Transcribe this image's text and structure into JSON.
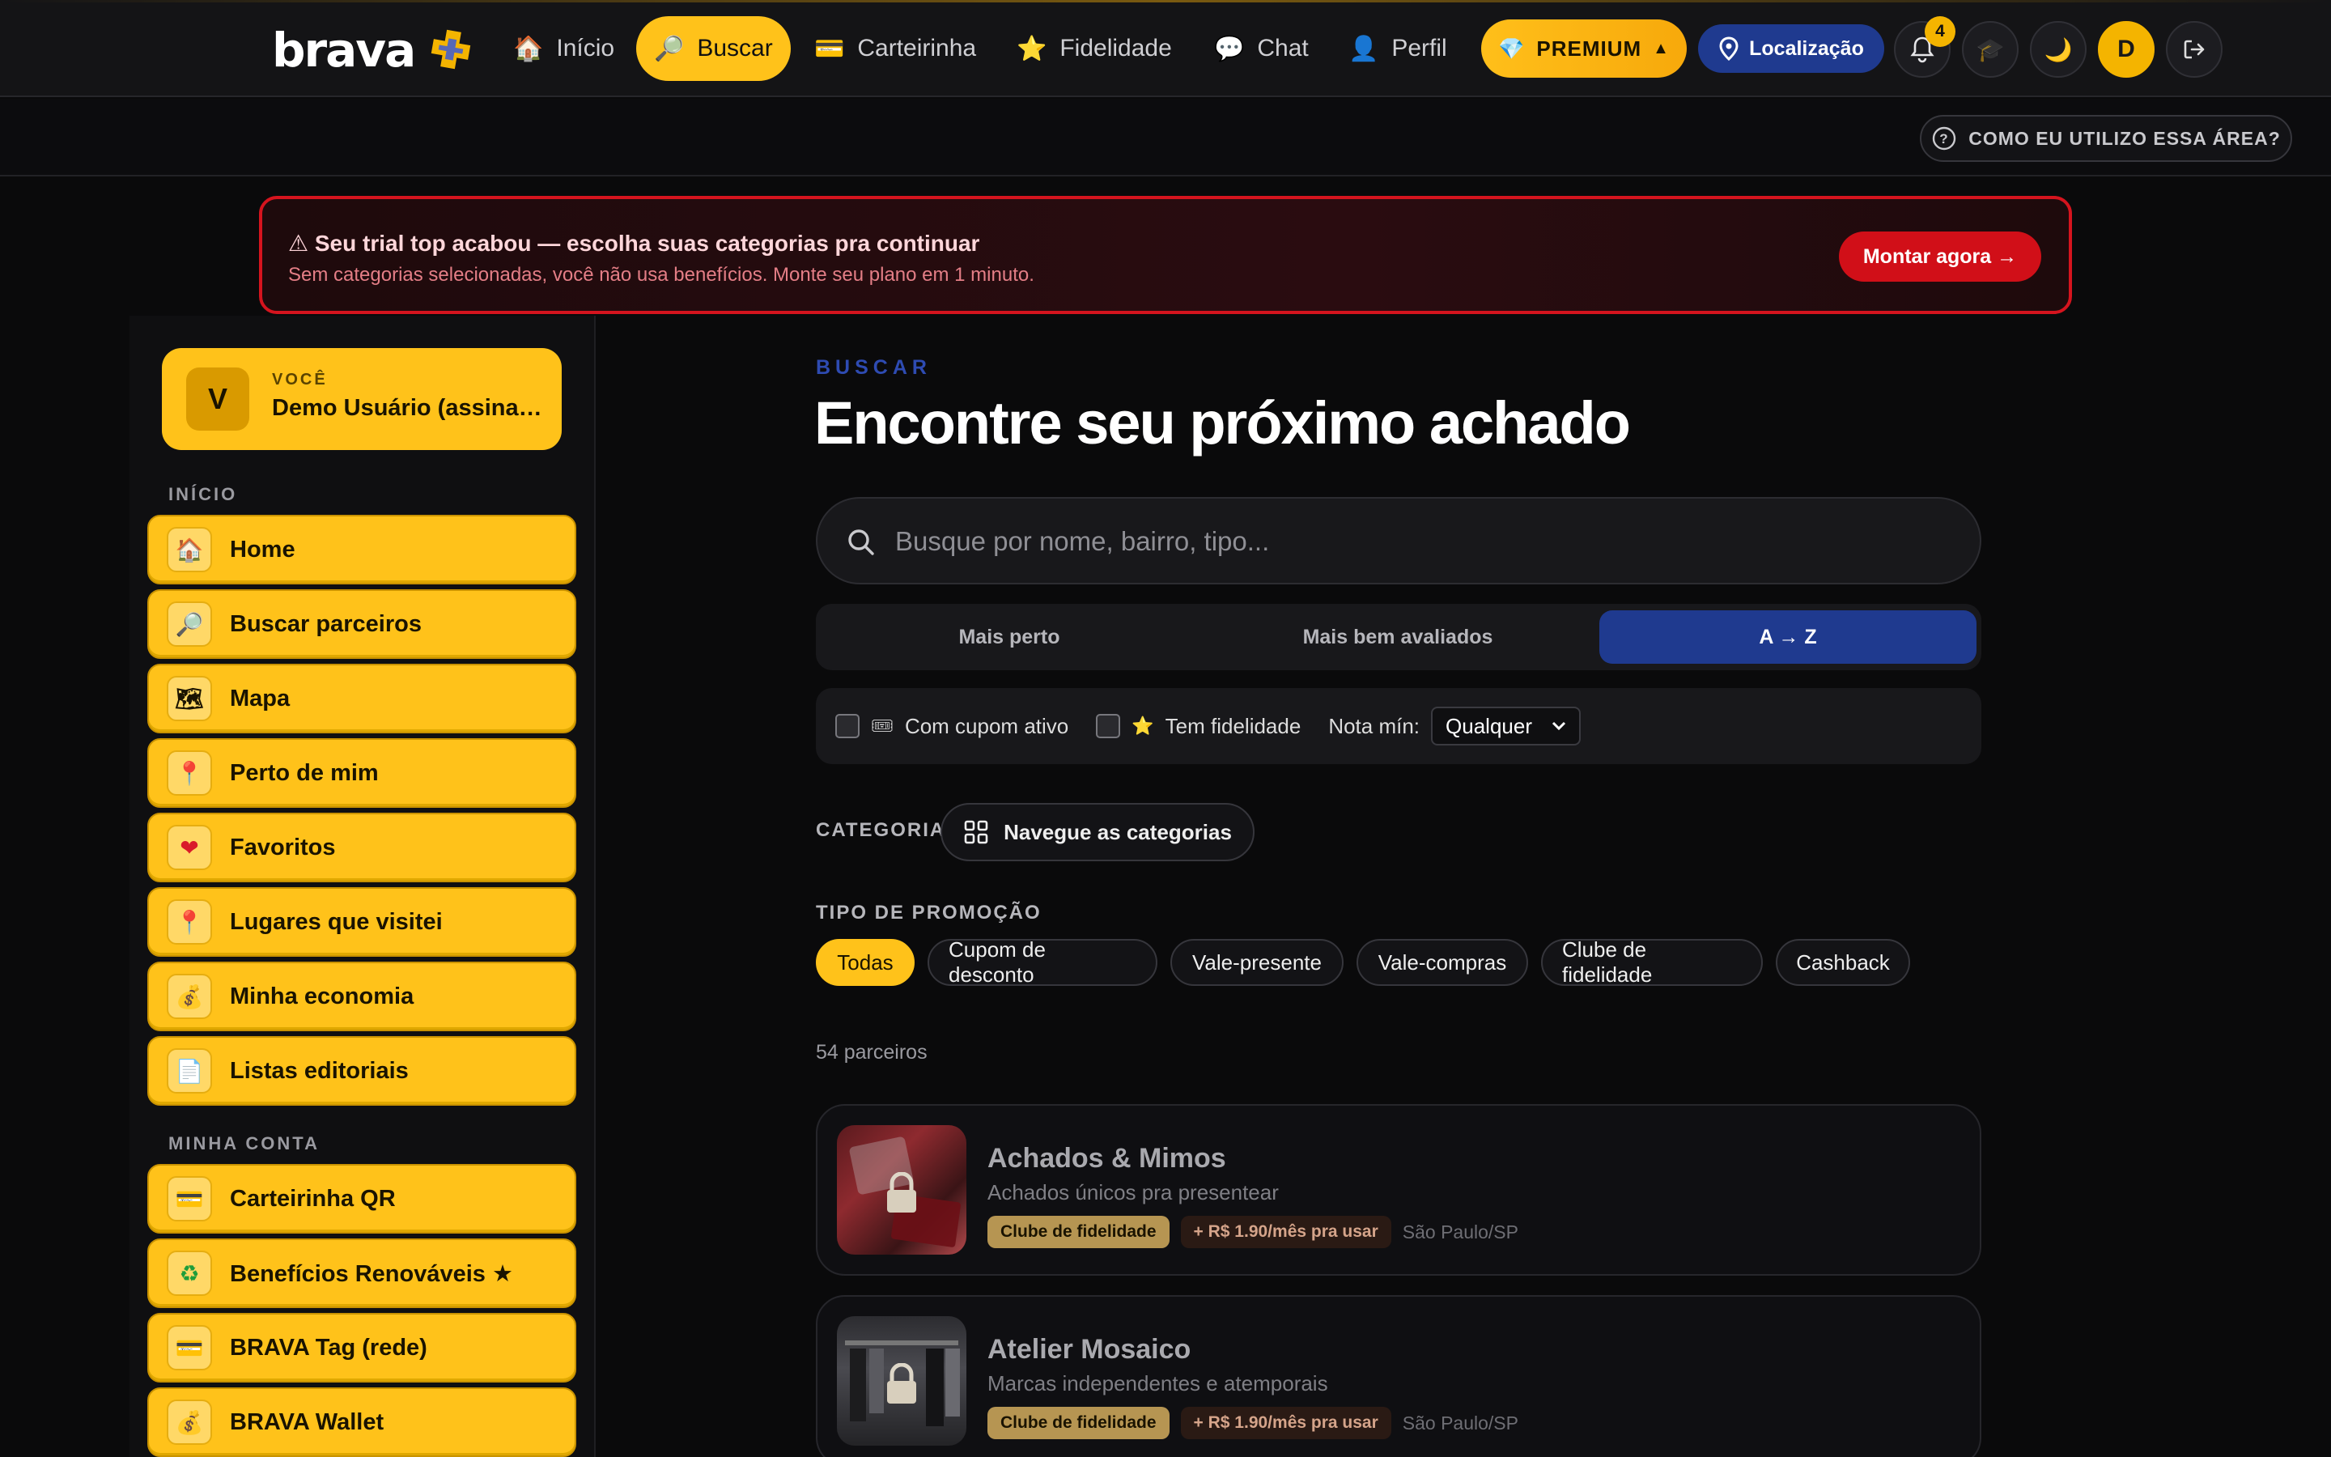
{
  "brand": {
    "name": "brava"
  },
  "nav": {
    "items": [
      {
        "label": "Início",
        "icon": "house-icon",
        "glyph": "🏠"
      },
      {
        "label": "Buscar",
        "icon": "magnifier-icon",
        "glyph": "🔎"
      },
      {
        "label": "Carteirinha",
        "icon": "card-icon",
        "glyph": "💳"
      },
      {
        "label": "Fidelidade",
        "icon": "star-icon",
        "glyph": "⭐"
      },
      {
        "label": "Chat",
        "icon": "chat-icon",
        "glyph": "💬"
      },
      {
        "label": "Perfil",
        "icon": "person-icon",
        "glyph": "👤"
      }
    ],
    "active": "Buscar",
    "premium_label": "PREMIUM",
    "location_label": "Localização",
    "notifications_count": "4",
    "avatar_letter": "D"
  },
  "subbar": {
    "help_label": "COMO EU UTILIZO ESSA ÁREA?"
  },
  "alert": {
    "title": "⚠ Seu trial top acabou — escolha suas categorias pra continuar",
    "subtitle": "Sem categorias selecionadas, você não usa benefícios. Monte seu plano em 1 minuto.",
    "button": "Montar agora →"
  },
  "sidebar": {
    "user": {
      "avatar_letter": "V",
      "kicker": "VOCÊ",
      "name": "Demo Usuário (assinante)"
    },
    "sections": [
      {
        "title": "INÍCIO",
        "items": [
          {
            "label": "Home",
            "glyph": "🏠",
            "icon": "house-icon"
          },
          {
            "label": "Buscar parceiros",
            "glyph": "🔎",
            "icon": "magnifier-icon"
          },
          {
            "label": "Mapa",
            "glyph": "🗺",
            "icon": "map-icon"
          },
          {
            "label": "Perto de mim",
            "glyph": "📍",
            "icon": "pin-icon"
          },
          {
            "label": "Favoritos",
            "glyph": "❤",
            "icon": "heart-icon"
          },
          {
            "label": "Lugares que visitei",
            "glyph": "📍",
            "icon": "pin-icon"
          },
          {
            "label": "Minha economia",
            "glyph": "💰",
            "icon": "money-bag-icon"
          },
          {
            "label": "Listas editoriais",
            "glyph": "📄",
            "icon": "document-icon"
          }
        ]
      },
      {
        "title": "MINHA CONTA",
        "items": [
          {
            "label": "Carteirinha QR",
            "glyph": "💳",
            "icon": "card-icon"
          },
          {
            "label": "Benefícios Renováveis ★",
            "glyph": "♻",
            "icon": "recycle-icon"
          },
          {
            "label": "BRAVA Tag (rede)",
            "glyph": "💳",
            "icon": "card-icon"
          },
          {
            "label": "BRAVA Wallet",
            "glyph": "💰",
            "icon": "money-bag-icon"
          }
        ]
      }
    ]
  },
  "main": {
    "kicker": "BUSCAR",
    "title": "Encontre seu próximo achado",
    "search_placeholder": "Busque por nome, bairro, tipo...",
    "sort_tabs": [
      "Mais perto",
      "Mais bem avaliados",
      "A → Z"
    ],
    "sort_active": "A → Z",
    "filters": {
      "coupon_label": "Com cupom ativo",
      "loyalty_label": "Tem fidelidade",
      "min_rating_label": "Nota mín:",
      "min_rating_value": "Qualquer"
    },
    "category_label": "CATEGORIA",
    "category_button": "Navegue as categorias",
    "promo_label": "TIPO DE PROMOÇÃO",
    "promo_chips": [
      "Todas",
      "Cupom de desconto",
      "Vale-presente",
      "Vale-compras",
      "Clube de fidelidade",
      "Cashback"
    ],
    "promo_active": "Todas",
    "results_count": "54 parceiros",
    "results": [
      {
        "name": "Achados & Mimos",
        "desc": "Achados únicos pra presentear",
        "tag": "Clube de fidelidade",
        "price": "+ R$ 1.90/mês pra usar",
        "city": "São Paulo/SP"
      },
      {
        "name": "Atelier Mosaico",
        "desc": "Marcas independentes e atemporais",
        "tag": "Clube de fidelidade",
        "price": "+ R$ 1.90/mês pra usar",
        "city": "São Paulo/SP"
      }
    ]
  },
  "colors": {
    "accent": "#ffc21a",
    "blue": "#1f3a8f",
    "alert_red": "#d5141e",
    "bg": "#0a0a0b"
  }
}
